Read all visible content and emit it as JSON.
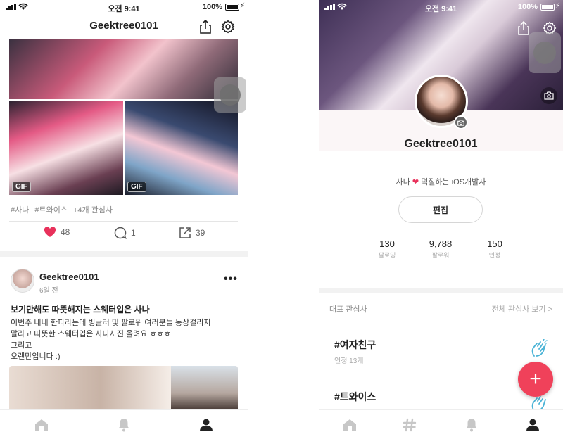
{
  "status_left": {
    "time": "오전 9:41",
    "battery": "100%"
  },
  "status_right": {
    "time": "오전 9:41",
    "battery": "100%"
  },
  "feed": {
    "nav_title": "Geektree0101",
    "gif_badge": "GIF",
    "tags": [
      "#사나",
      "#트와이스",
      "+4개 관심사"
    ],
    "likes": "48",
    "comments": "1",
    "shares": "39",
    "post": {
      "author": "Geektree0101",
      "time": "6일 전",
      "title": "보기만해도 따뜻해지는 스웨터입은 사나",
      "body_lines": [
        "이번주 내내 한파라는데 빙글러 및 팔로워 여러분들 동상걸리지",
        "말라고 따뜻한 스웨터입은 사나사진 올려요 ㅎㅎㅎ",
        "그리고",
        "오랜만입니다 :)"
      ]
    }
  },
  "profile": {
    "name": "Geektree0101",
    "bio_left": "사나",
    "bio_right": "덕질하는 iOS개발자",
    "edit_label": "편집",
    "stats": [
      {
        "value": "130",
        "label": "팔로잉"
      },
      {
        "value": "9,788",
        "label": "팔로워"
      },
      {
        "value": "150",
        "label": "인정"
      }
    ],
    "section_title": "대표 관심사",
    "section_link": "전체 관심사 보기 >",
    "interests": [
      {
        "title": "#여자친구",
        "count": "인정 13개"
      },
      {
        "title": "#트와이스",
        "count": ""
      }
    ],
    "fab_label": "+"
  },
  "colors": {
    "accent": "#f0415a",
    "like": "#e8315b"
  }
}
